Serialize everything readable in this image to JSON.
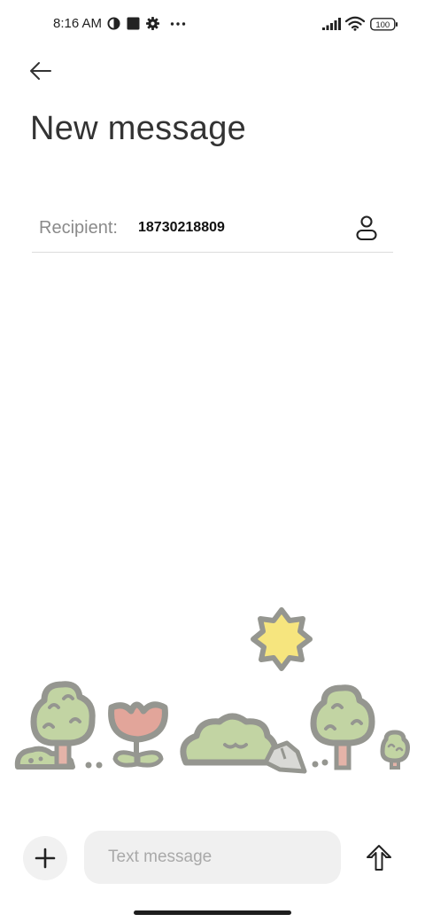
{
  "status_bar": {
    "time": "8:16 AM",
    "left_icons": [
      "data-saver-icon",
      "square-notification-icon",
      "settings-gear-icon",
      "more-dots-icon"
    ],
    "right_icons": [
      "signal-bars-icon",
      "wifi-icon",
      "battery-icon"
    ],
    "battery_level": "100"
  },
  "header": {
    "back_icon": "back-arrow-icon",
    "title": "New message"
  },
  "recipient": {
    "label": "Recipient:",
    "value": "18730218809",
    "contact_icon": "contact-person-icon"
  },
  "composer": {
    "attach_icon": "plus-icon",
    "placeholder": "Text message",
    "value": "",
    "send_icon": "send-arrow-up-icon"
  },
  "colors": {
    "tree_green": "#c2d4a3",
    "outline_gray": "#959690",
    "flower_red": "#e2a59a",
    "sun_yellow": "#f6e57e",
    "trunk_pink": "#e4b3a8"
  }
}
